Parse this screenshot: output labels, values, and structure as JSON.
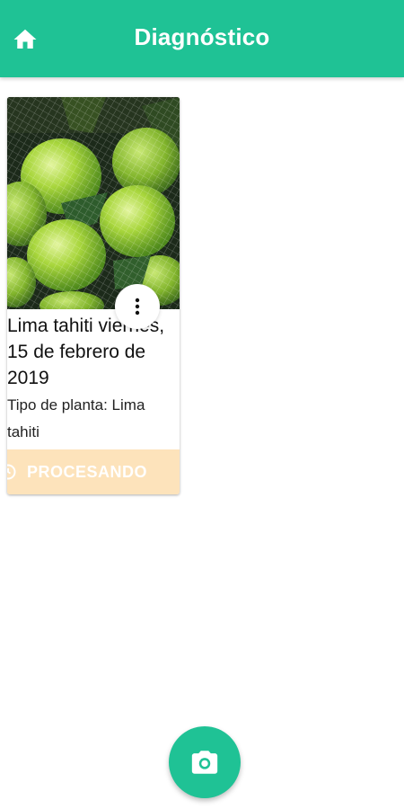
{
  "appbar": {
    "title": "Diagnóstico",
    "home_icon": "home-icon",
    "color": "#1fc295"
  },
  "card": {
    "title": "Lima tahiti viernes, 15 de febrero de 2019",
    "subtitle": "Tipo de planta: Lima tahiti",
    "status": "PROCESANDO",
    "status_icon": "clock-icon",
    "status_bg": "#fde3bb",
    "more_icon": "more-vertical-icon",
    "image": "limes-photo"
  },
  "fab": {
    "icon": "camera-icon"
  }
}
